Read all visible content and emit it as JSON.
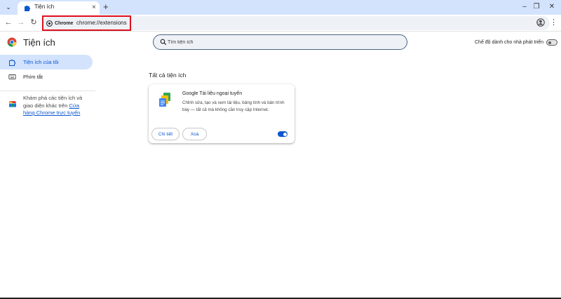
{
  "browser": {
    "tab_title": "Tiện ích",
    "tab_close": "×",
    "new_tab": "+",
    "tab_search": "⌄",
    "omnibox": {
      "chip_label": "Chrome",
      "url": "chrome://extensions"
    },
    "controls": {
      "minimize": "–",
      "restore": "❐",
      "close": "✕",
      "back": "←",
      "forward": "→",
      "reload": "↻",
      "bookmark": "☆",
      "menu": "⋮"
    }
  },
  "header": {
    "title": "Tiện ích",
    "search_placeholder": "Tìm tiện ích",
    "dev_mode_label": "Chế độ dành cho nhà phát triển",
    "dev_mode_on": false
  },
  "sidebar": {
    "items": [
      {
        "label": "Tiện ích của tôi",
        "icon": "puzzle-icon",
        "active": true
      },
      {
        "label": "Phím tắt",
        "icon": "keyboard-icon",
        "active": false
      }
    ],
    "store_text_pre": "Khám phá các tiện ích và giao diện khác trên ",
    "store_link": "Cửa hàng Chrome trực tuyến"
  },
  "main": {
    "section_title": "Tất cả tiện ích",
    "extensions": [
      {
        "name": "Google Tài liệu ngoại tuyến",
        "description": "Chỉnh sửa, tạo và xem tài liệu, bảng tính và bản trình bày — tất cả mà không cần truy cập Internet.",
        "details_label": "Chi tiết",
        "remove_label": "Xoá",
        "enabled": true
      }
    ]
  },
  "colors": {
    "accent": "#0b57d0",
    "tabstrip": "#d3e3fd",
    "highlight_box": "#e0101f"
  }
}
